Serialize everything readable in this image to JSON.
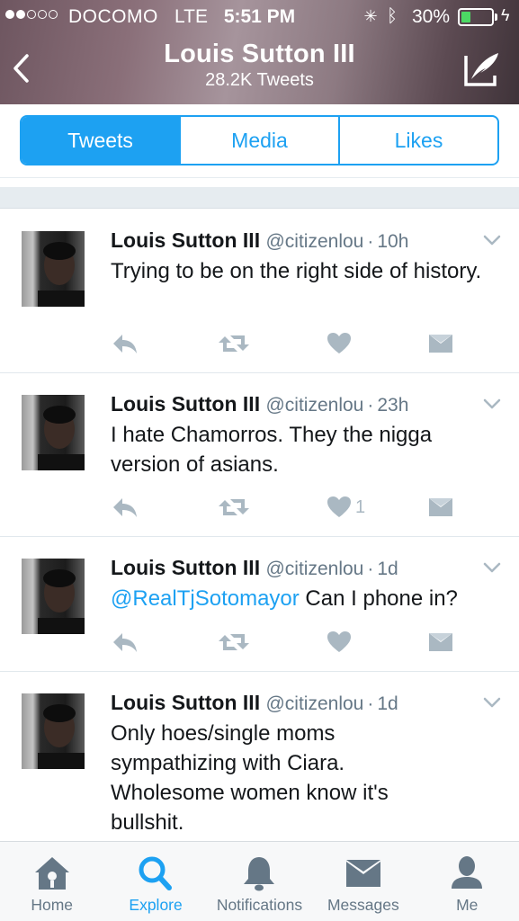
{
  "status_bar": {
    "carrier": "DOCOMO",
    "network": "LTE",
    "time": "5:51 PM",
    "battery_percent": "30%",
    "battery_level": 0.3,
    "signal_bars": 2
  },
  "header": {
    "title": "Louis Sutton III",
    "tweet_count": "28.2K Tweets",
    "back_icon": "chevron-left-icon",
    "compose_icon": "compose-tweet-icon"
  },
  "segments": [
    {
      "label": "Tweets",
      "active": true
    },
    {
      "label": "Media",
      "active": false
    },
    {
      "label": "Likes",
      "active": false
    }
  ],
  "tweets": [
    {
      "name": "Louis Sutton III",
      "handle": "@citizenlou",
      "sep": "·",
      "time": "10h",
      "mention": "",
      "text": "Trying to be on the right side of history.",
      "like_count": ""
    },
    {
      "name": "Louis Sutton III",
      "handle": "@citizenlou",
      "sep": "·",
      "time": "23h",
      "mention": "",
      "text": "I hate Chamorros. They the nigga version of asians.",
      "like_count": "1"
    },
    {
      "name": "Louis Sutton III",
      "handle": "@citizenlou",
      "sep": "·",
      "time": "1d",
      "mention": "@RealTjSotomayor",
      "text": " Can I phone in?",
      "like_count": ""
    },
    {
      "name": "Louis Sutton III",
      "handle": "@citizenlou",
      "sep": "·",
      "time": "1d",
      "mention": "",
      "text": "Only hoes/single moms sympathizing with Ciara. Wholesome women know it's bullshit.",
      "like_count": ""
    }
  ],
  "tabbar": [
    {
      "label": "Home",
      "icon": "home-icon",
      "active": false
    },
    {
      "label": "Explore",
      "icon": "search-icon",
      "active": true
    },
    {
      "label": "Notifications",
      "icon": "bell-icon",
      "active": false
    },
    {
      "label": "Messages",
      "icon": "envelope-icon",
      "active": false
    },
    {
      "label": "Me",
      "icon": "person-icon",
      "active": false
    }
  ],
  "colors": {
    "accent": "#1da1f2",
    "action_gray": "#aab8c2",
    "meta_gray": "#657786"
  }
}
